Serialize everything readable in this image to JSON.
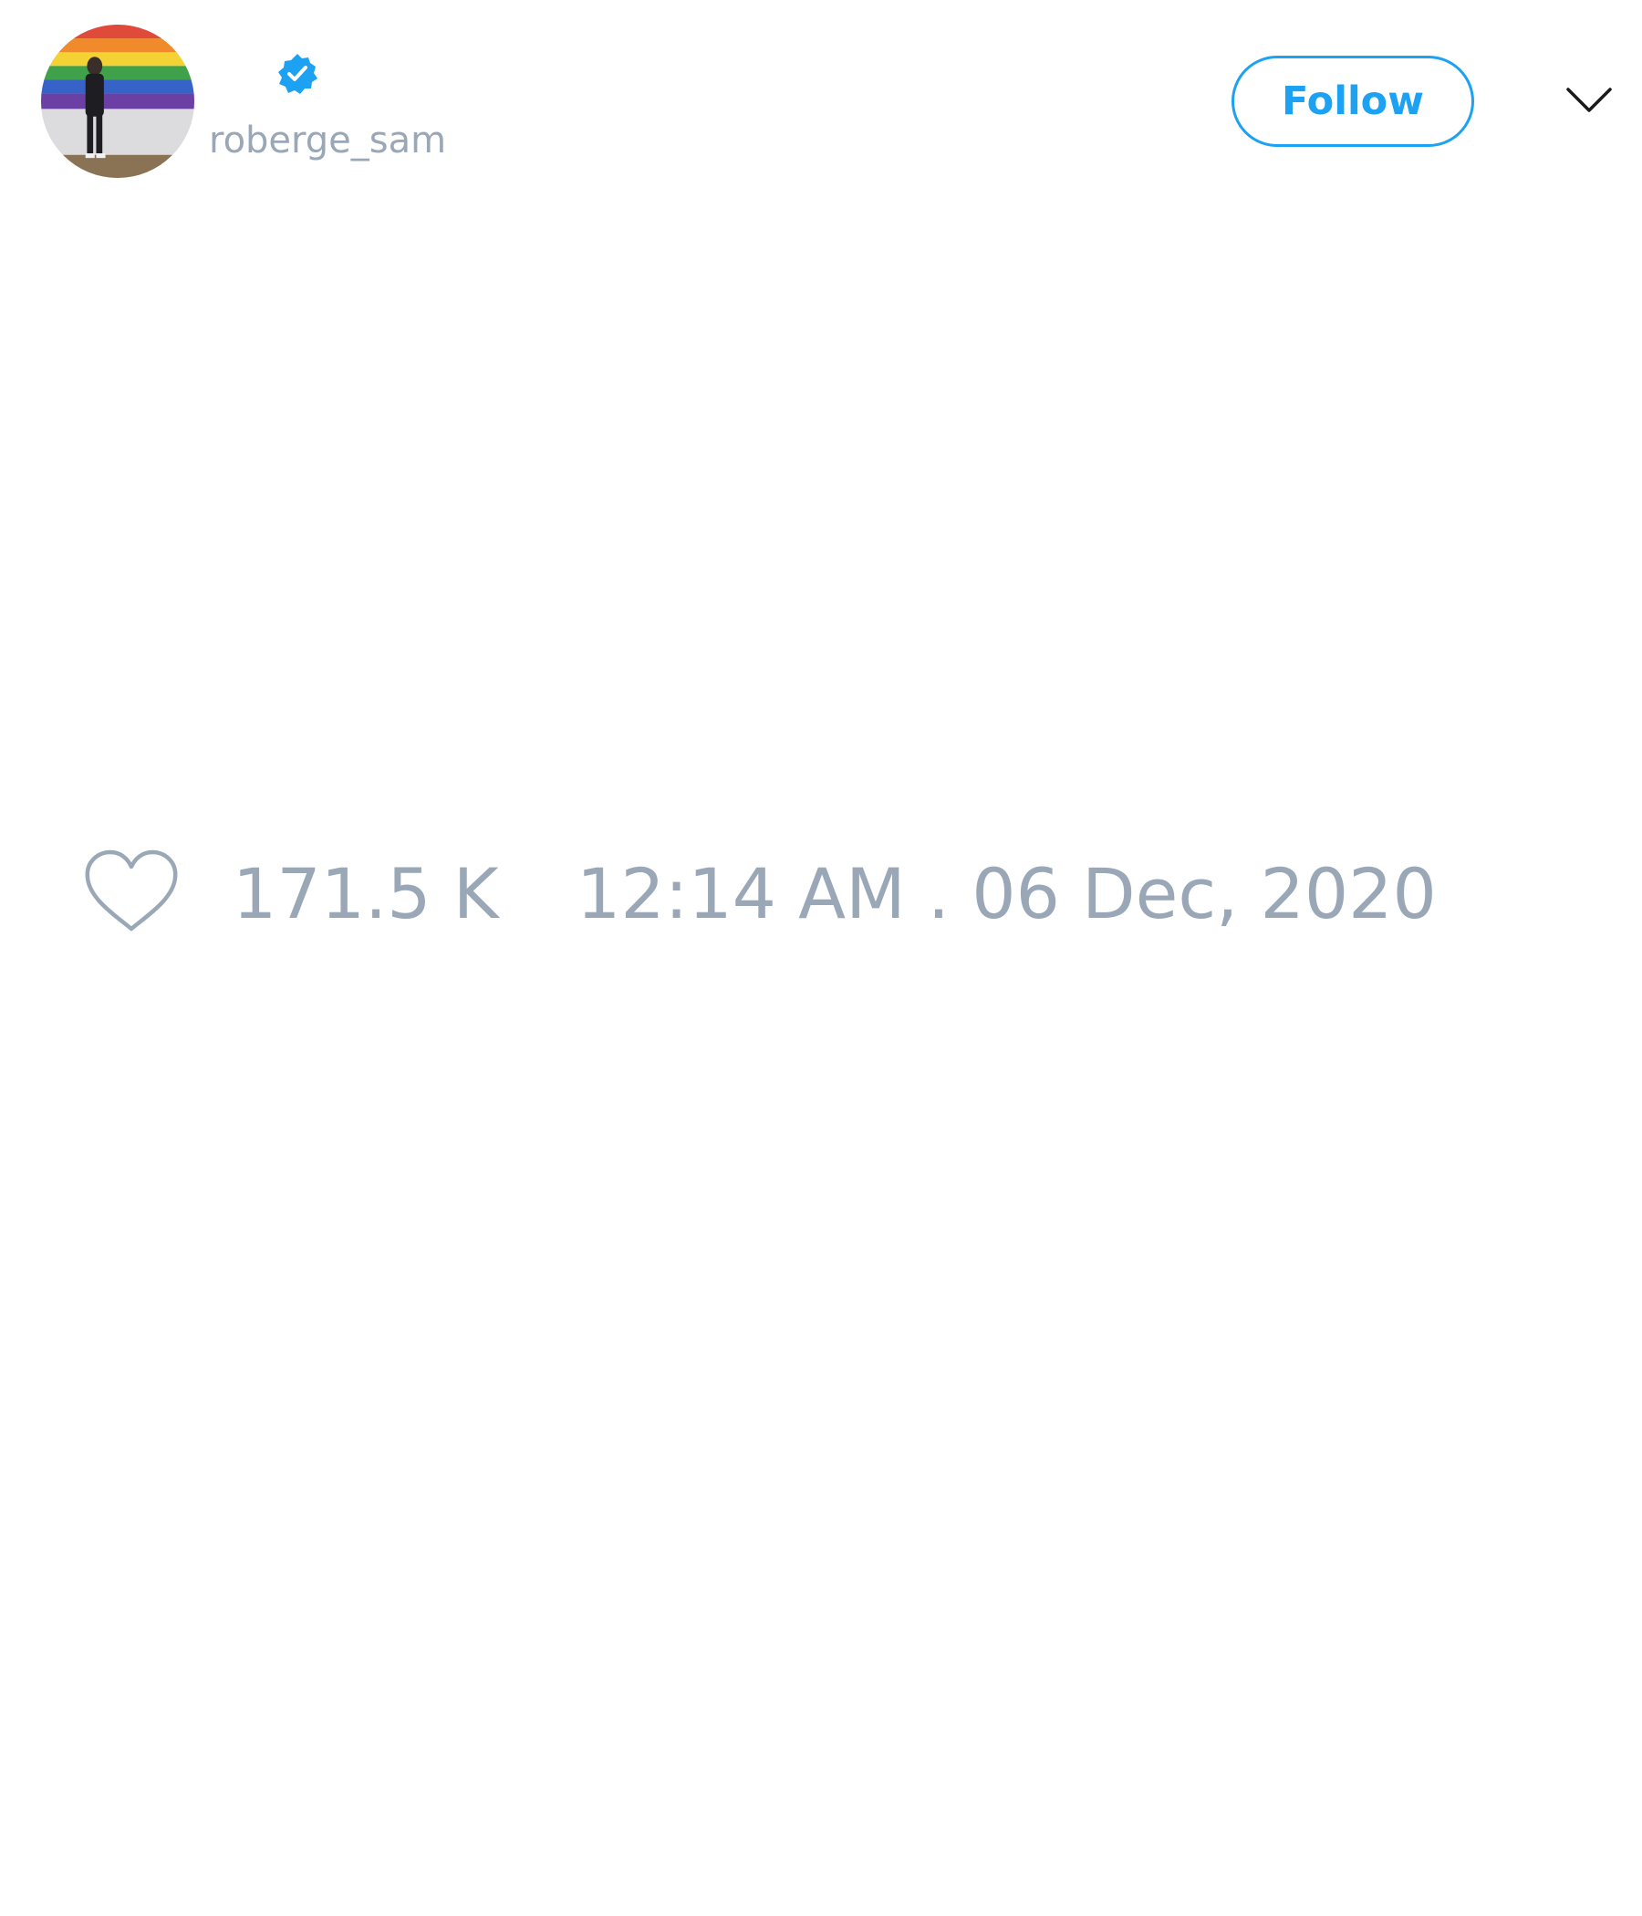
{
  "author": {
    "handle": "roberge_sam",
    "verified": true,
    "avatar": "profile-photo-rainbow-flag"
  },
  "header": {
    "follow_label": "Follow",
    "menu_icon": "chevron-down-icon"
  },
  "stats": {
    "like_icon": "heart-outline-icon",
    "likes": "171.5 K",
    "timestamp": "12:14 AM . 06 Dec, 2020"
  },
  "colors": {
    "accent": "#1da1f2",
    "muted_text": "#9aa7b7",
    "background": "#ffffff"
  }
}
